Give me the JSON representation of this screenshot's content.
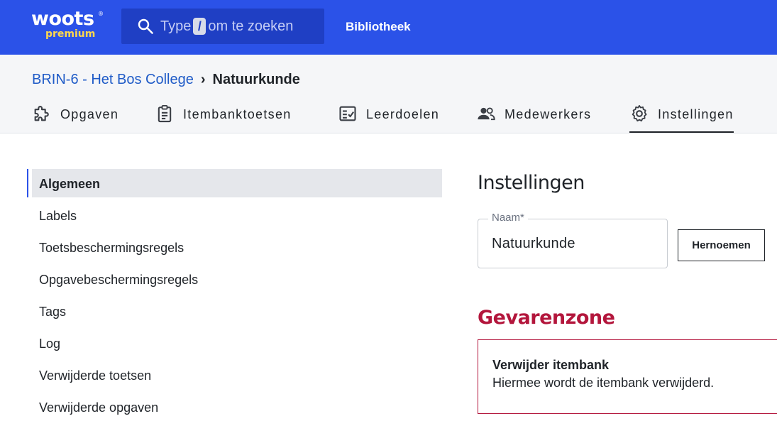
{
  "brand": {
    "name": "woots",
    "reg": "®",
    "tier": "premium"
  },
  "search": {
    "prefix": "Type",
    "key": "/",
    "suffix": "om te zoeken",
    "icon": "search-icon"
  },
  "topnav": {
    "library": "Bibliotheek"
  },
  "breadcrumb": {
    "parent": "BRIN-6 - Het Bos College",
    "separator": "›",
    "current": "Natuurkunde"
  },
  "tabs": [
    {
      "label": "Opgaven",
      "icon": "puzzle-icon"
    },
    {
      "label": "Itembanktoetsen",
      "icon": "clipboard-icon"
    },
    {
      "label": "Leerdoelen",
      "icon": "checklist-icon"
    },
    {
      "label": "Medewerkers",
      "icon": "people-icon"
    },
    {
      "label": "Instellingen",
      "icon": "gear-icon",
      "active": true
    }
  ],
  "sidebar": {
    "items": [
      {
        "label": "Algemeen",
        "active": true
      },
      {
        "label": "Labels"
      },
      {
        "label": "Toetsbeschermingsregels"
      },
      {
        "label": "Opgavebeschermingsregels"
      },
      {
        "label": "Tags"
      },
      {
        "label": "Log"
      },
      {
        "label": "Verwijderde toetsen"
      },
      {
        "label": "Verwijderde opgaven"
      }
    ]
  },
  "main": {
    "title": "Instellingen",
    "name_field": {
      "label": "Naam*",
      "value": "Natuurkunde"
    },
    "rename_button": "Hernoemen",
    "danger": {
      "title": "Gevarenzone",
      "heading": "Verwijder itembank",
      "description": "Hiermee wordt de itembank verwijderd."
    }
  },
  "colors": {
    "topbar": "#2b52e8",
    "search_bg": "#1f3fc4",
    "brand_accent": "#ffd84d",
    "link": "#1f5bc7",
    "danger": "#b3163c",
    "active_bg": "#e5e7eb"
  }
}
